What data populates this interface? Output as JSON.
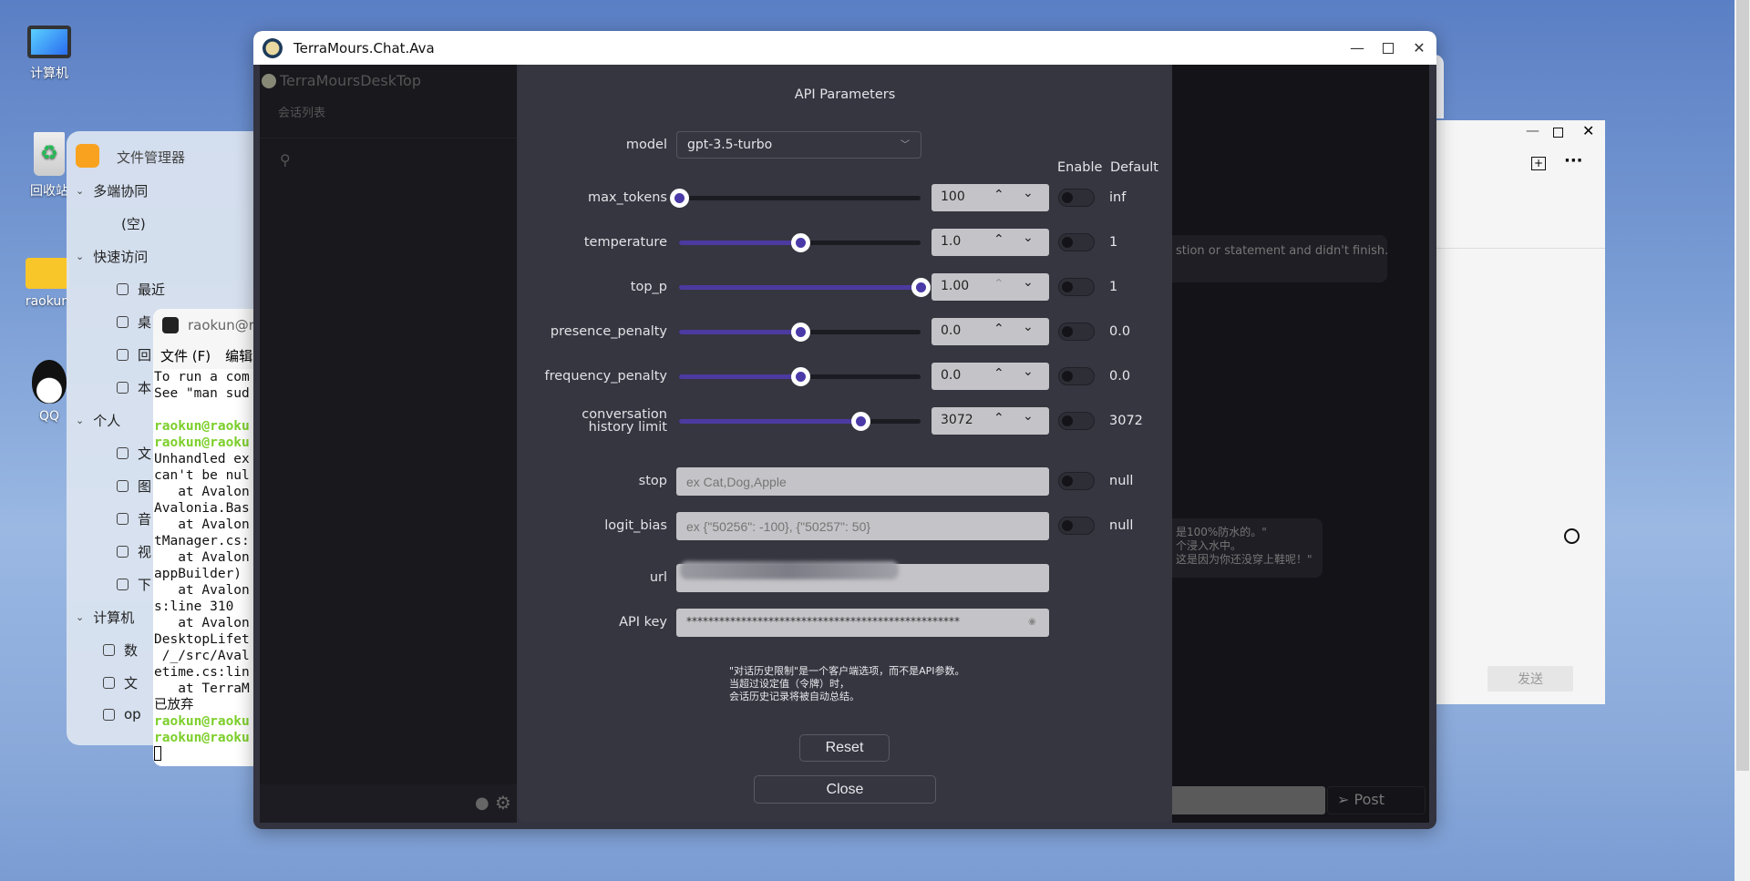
{
  "desktop": {
    "icons": [
      {
        "label": "计算机",
        "icon": "computer-icon"
      },
      {
        "label": "回收站",
        "icon": "trash-icon"
      },
      {
        "label": "raokun",
        "icon": "home-folder-icon"
      },
      {
        "label": "QQ",
        "icon": "qq-penguin-icon"
      }
    ]
  },
  "file_manager": {
    "title": "文件管理器",
    "sections": [
      {
        "label": "多端协同",
        "items": [
          "(空)"
        ]
      },
      {
        "label": "快速访问",
        "items": [
          "最近",
          "桌",
          "回",
          "本"
        ]
      },
      {
        "label": "个人",
        "items": [
          "文",
          "图",
          "音",
          "视",
          "下"
        ]
      },
      {
        "label": "计算机",
        "items": [
          "数",
          "文",
          "op"
        ]
      }
    ]
  },
  "terminal": {
    "title": "raokun@r",
    "menu": [
      "文件 (F)",
      "编辑"
    ],
    "lines": [
      {
        "t": "To run a com"
      },
      {
        "t": "See \"man sud"
      },
      {
        "t": ""
      },
      {
        "t": "raokun@raoku",
        "g": true
      },
      {
        "t": "raokun@raoku",
        "g": true
      },
      {
        "t": "Unhandled ex"
      },
      {
        "t": "can't be nul"
      },
      {
        "t": "   at Avalon"
      },
      {
        "t": "Avalonia.Bas"
      },
      {
        "t": "   at Avalon"
      },
      {
        "t": "tManager.cs:"
      },
      {
        "t": "   at Avalon"
      },
      {
        "t": "appBuilder)"
      },
      {
        "t": "   at Avalon"
      },
      {
        "t": "s:line 310"
      },
      {
        "t": "   at Avalon"
      },
      {
        "t": "DesktopLifet"
      },
      {
        "t": " /_/src/Aval"
      },
      {
        "t": "etime.cs:lin"
      },
      {
        "t": "   at TerraM"
      },
      {
        "t": "已放弃"
      },
      {
        "t": "raokun@raoku",
        "g": true
      },
      {
        "t": "raokun@raoku",
        "g": true
      }
    ]
  },
  "main_window": {
    "title": "TerraMours.Chat.Ava",
    "app_name": "TerraMoursDeskTop",
    "sidebar_heading": "会话列表",
    "chat_snippet_1": "stion or statement and didn't finish.",
    "chat_snippet_2": [
      "是100%防水的。\"",
      "个浸入水中。",
      "这是因为你还没穿上鞋呢！\""
    ],
    "post_label": "Post"
  },
  "side_window": {
    "send_label": "发送"
  },
  "dialog": {
    "title": "API Parameters",
    "model_label": "model",
    "model_value": "gpt-3.5-turbo",
    "enable_header": "Enable",
    "default_header": "Default",
    "params": [
      {
        "label": "max_tokens",
        "value": "100",
        "slider_fraction": 0.0,
        "enabled": false,
        "default": "inf",
        "up_disabled": false
      },
      {
        "label": "temperature",
        "value": "1.0",
        "slider_fraction": 0.5,
        "enabled": false,
        "default": "1",
        "up_disabled": false
      },
      {
        "label": "top_p",
        "value": "1.00",
        "slider_fraction": 1.0,
        "enabled": false,
        "default": "1",
        "up_disabled": true
      },
      {
        "label": "presence_penalty",
        "value": "0.0",
        "slider_fraction": 0.5,
        "enabled": false,
        "default": "0.0",
        "up_disabled": false
      },
      {
        "label": "frequency_penalty",
        "value": "0.0",
        "slider_fraction": 0.5,
        "enabled": false,
        "default": "0.0",
        "up_disabled": false
      },
      {
        "label": "conversation history limit",
        "value": "3072",
        "slider_fraction": 0.75,
        "enabled": false,
        "default": "3072",
        "up_disabled": false
      }
    ],
    "stop": {
      "label": "stop",
      "placeholder": "ex Cat,Dog,Apple",
      "enabled": false,
      "default": "null"
    },
    "logit_bias": {
      "label": "logit_bias",
      "placeholder": "ex {\"50256\": -100}, {\"50257\": 50}",
      "enabled": false,
      "default": "null"
    },
    "url": {
      "label": "url"
    },
    "api_key": {
      "label": "API key",
      "value": "**************************************************"
    },
    "note": [
      "\"对话历史限制\"是一个客户端选项，而不是API参数。",
      "当超过设定值（令牌）时，",
      "会话历史记录将被自动总结。"
    ],
    "reset_label": "Reset",
    "close_label": "Close"
  },
  "colors": {
    "accent": "#4a3aa8",
    "dialog_bg": "#363641",
    "terminal_prompt": "#7ccf2a"
  }
}
